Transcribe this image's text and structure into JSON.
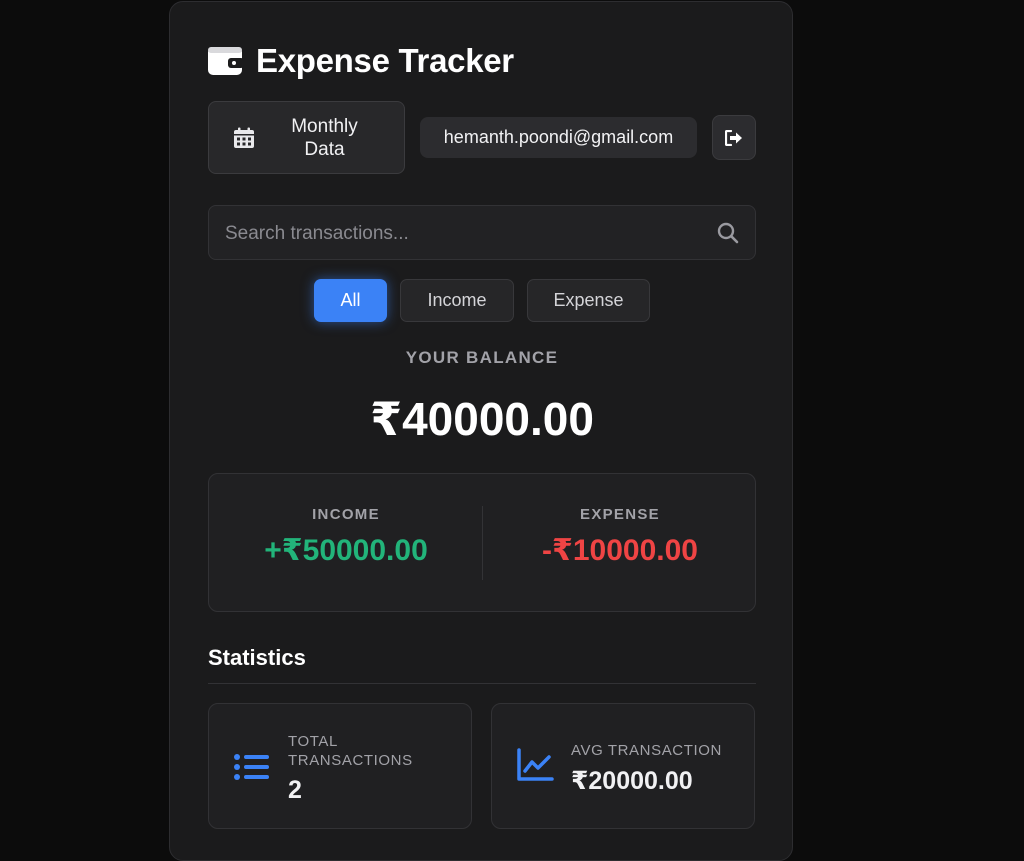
{
  "header": {
    "title": "Expense Tracker",
    "monthly_button_label": "Monthly\nData",
    "user_email": "hemanth.poondi@gmail.com"
  },
  "search": {
    "placeholder": "Search transactions...",
    "value": ""
  },
  "filters": {
    "items": [
      {
        "label": "All",
        "active": true
      },
      {
        "label": "Income",
        "active": false
      },
      {
        "label": "Expense",
        "active": false
      }
    ]
  },
  "balance": {
    "label": "YOUR BALANCE",
    "value": "₹40000.00"
  },
  "summary": {
    "income_label": "INCOME",
    "income_value": "+₹50000.00",
    "expense_label": "EXPENSE",
    "expense_value": "-₹10000.00"
  },
  "statistics": {
    "title": "Statistics",
    "cards": [
      {
        "label": "TOTAL TRANSACTIONS",
        "value": "2"
      },
      {
        "label": "AVG TRANSACTION",
        "value": "₹20000.00"
      }
    ]
  },
  "icons": {
    "title": "wallet-icon",
    "monthly": "calendar-icon",
    "logout": "sign-out-icon",
    "search": "search-icon",
    "stat_total": "list-icon",
    "stat_avg": "chart-line-icon"
  },
  "colors": {
    "accent": "#3b82f6",
    "income": "#22b47a",
    "expense": "#ef4444",
    "background": "#0c0c0c",
    "card": "#1b1b1c"
  }
}
